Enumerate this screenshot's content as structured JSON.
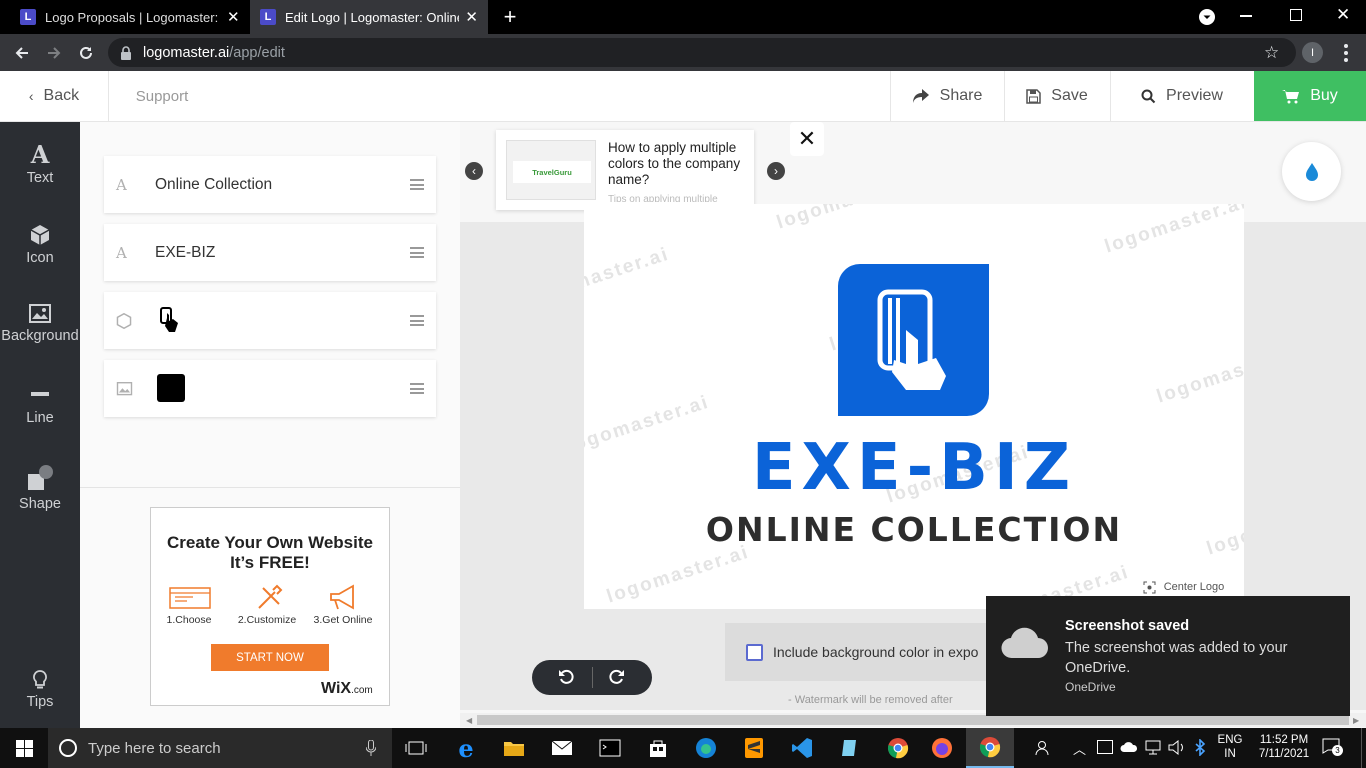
{
  "browser": {
    "tabs": [
      {
        "title": "Logo Proposals | Logomaster: On",
        "icon_letter": "L"
      },
      {
        "title": "Edit Logo | Logomaster: Online Lo",
        "icon_letter": "L"
      }
    ],
    "url_host": "logomaster.ai",
    "url_path": "/app/edit",
    "profile_initial": "I"
  },
  "header": {
    "back_label": "Back",
    "support_label": "Support",
    "share_label": "Share",
    "save_label": "Save",
    "preview_label": "Preview",
    "buy_label": "Buy"
  },
  "rail": {
    "items": [
      {
        "label": "Text",
        "icon": "text-icon"
      },
      {
        "label": "Icon",
        "icon": "cube-icon"
      },
      {
        "label": "Background",
        "icon": "image-icon"
      },
      {
        "label": "Line",
        "icon": "line-icon"
      },
      {
        "label": "Shape",
        "icon": "shape-icon"
      }
    ],
    "tips_label": "Tips"
  },
  "layers": [
    {
      "type": "text",
      "label": "Online Collection"
    },
    {
      "type": "text",
      "label": "EXE-BIZ"
    },
    {
      "type": "icon",
      "label": ""
    },
    {
      "type": "background",
      "label": ""
    }
  ],
  "ad": {
    "headline": "Create Your Own Website",
    "subline": "It’s FREE!",
    "steps": [
      "1.Choose",
      "2.Customize",
      "3.Get Online"
    ],
    "cta": "START NOW",
    "brand": "WiX",
    "brand_suffix": ".com"
  },
  "tip": {
    "text": "How to apply multiple colors to the company name?",
    "subtext": "Tips on applying multiple",
    "thumb_brand": "TravelGuru"
  },
  "logo": {
    "name": "EXE-BIZ",
    "tagline": "ONLINE COLLECTION",
    "icon_color": "#0b63d8",
    "tagline_color": "#2d2d2d"
  },
  "watermark_text": "logomaster.ai",
  "center_logo_label": "Center Logo",
  "include_bg_label": "Include background color in expo",
  "watermark_note": "- Watermark will be removed after",
  "toast": {
    "title": "Screenshot saved",
    "body": "The screenshot was added to your OneDrive.",
    "source": "OneDrive"
  },
  "taskbar": {
    "search_placeholder": "Type here to search",
    "lang1": "ENG",
    "lang2": "IN",
    "time": "11:52 PM",
    "date": "7/11/2021",
    "notification_count": "3"
  },
  "colors": {
    "accent_green": "#3fbf62",
    "brand_blue": "#0b63d8"
  }
}
